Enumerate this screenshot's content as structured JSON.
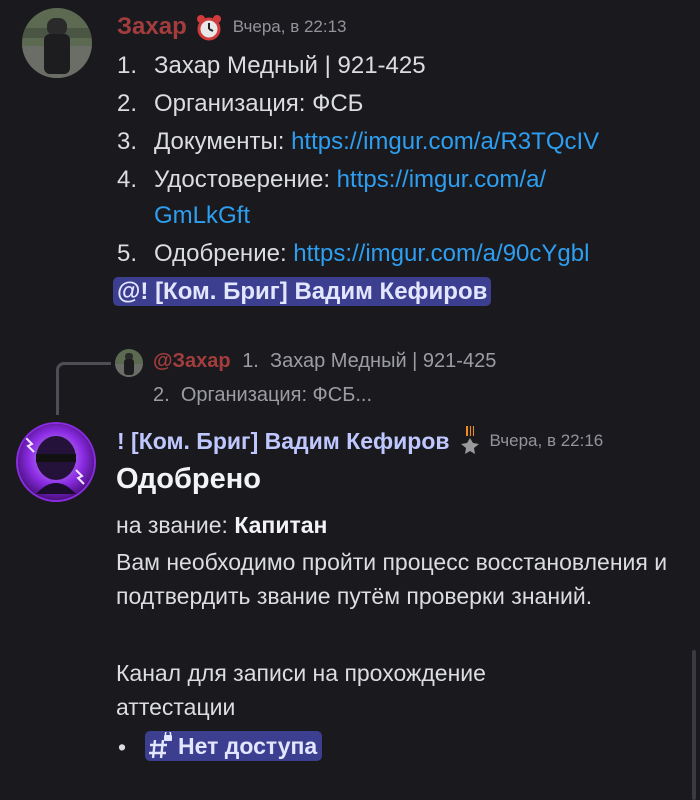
{
  "message1": {
    "author": "Захар",
    "author_color": "#a33d3d",
    "badge_icon": "alarm-clock-icon",
    "timestamp": "Вчера, в 22:13",
    "list": [
      {
        "num": "1.",
        "text": "Захар Медный | 921-425",
        "link": ""
      },
      {
        "num": "2.",
        "text": "Организация: ФСБ",
        "link": ""
      },
      {
        "num": "3.",
        "text": "Документы: ",
        "link": "https://imgur.com/a/R3TQcIV"
      },
      {
        "num": "4.",
        "text": "Удостоверение: ",
        "link": "https://imgur.com/a/",
        "link_cont": "GmLkGft"
      },
      {
        "num": "5.",
        "text": "Одобрение: ",
        "link": "https://imgur.com/a/90cYgbl"
      }
    ],
    "mention": "@! [Ком. Бриг] Вадим Кефиров"
  },
  "reply_preview": {
    "author": "@Захар",
    "line1_num": "1.",
    "line1_text": "Захар Медный | 921-425",
    "line2_num": "2.",
    "line2_text": "Организация: ФСБ..."
  },
  "message2": {
    "author": "! [Ком. Бриг] Вадим Кефиров",
    "author_color": "#bfc7ff",
    "badge_icon": "st-george-ribbon-icon",
    "timestamp": "Вчера, в 22:16",
    "heading": "Одобрено",
    "rank_label": "на звание: ",
    "rank_value": "Капитан",
    "paragraph1": "Вам необходимо пройти процесс восстановления и подтвердить звание путём проверки знаний.",
    "paragraph2": "Канал для записи на прохождение аттестации",
    "channel_bullet": "•",
    "channel_name": "Нет доступа"
  }
}
